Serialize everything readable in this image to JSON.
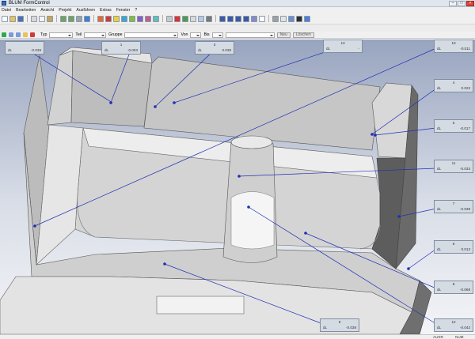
{
  "window": {
    "title": "BLUM FormControl"
  },
  "menu": [
    "Datei",
    "Bearbeiten",
    "Ansicht",
    "Projekt",
    "Ausführen",
    "Extras",
    "Fenster",
    "?"
  ],
  "toolbar3": {
    "combo_typ": "Typ",
    "combo_teil": "Teil",
    "combo_gruppe": "Gruppe",
    "von": "Von",
    "bis": "Bis",
    "neu_button": "Neu",
    "loeschen_button": "Löschen"
  },
  "labels": [
    {
      "num": "1",
      "dl": "dL",
      "val": "-0.003"
    },
    {
      "num": "2",
      "dl": "dL",
      "val": "-0.039"
    },
    {
      "num": "3",
      "dl": "dL",
      "val": "0.038"
    },
    {
      "num": "13",
      "dl": "dL",
      "val": "-"
    },
    {
      "num": "10",
      "dl": "dL",
      "val": "-0.011"
    },
    {
      "num": "4",
      "dl": "dL",
      "val": "0.023"
    },
    {
      "num": "5",
      "dl": "dL",
      "val": "-0.017"
    },
    {
      "num": "11",
      "dl": "dL",
      "val": "-0.033"
    },
    {
      "num": "7",
      "dl": "dL",
      "val": "-0.039"
    },
    {
      "num": "6",
      "dl": "dL",
      "val": "0.013"
    },
    {
      "num": "8",
      "dl": "dL",
      "val": "-0.068"
    },
    {
      "num": "9",
      "dl": "dL",
      "val": "-0.038"
    },
    {
      "num": "12",
      "dl": "dL",
      "val": "-0.042"
    }
  ],
  "status": {
    "ausr": "AUSR",
    "num": "NUM"
  },
  "colors": {
    "leader_line": "#1f2fb5",
    "label_bg": "#d5dbe3",
    "part_gray": "#c9c9c9"
  }
}
